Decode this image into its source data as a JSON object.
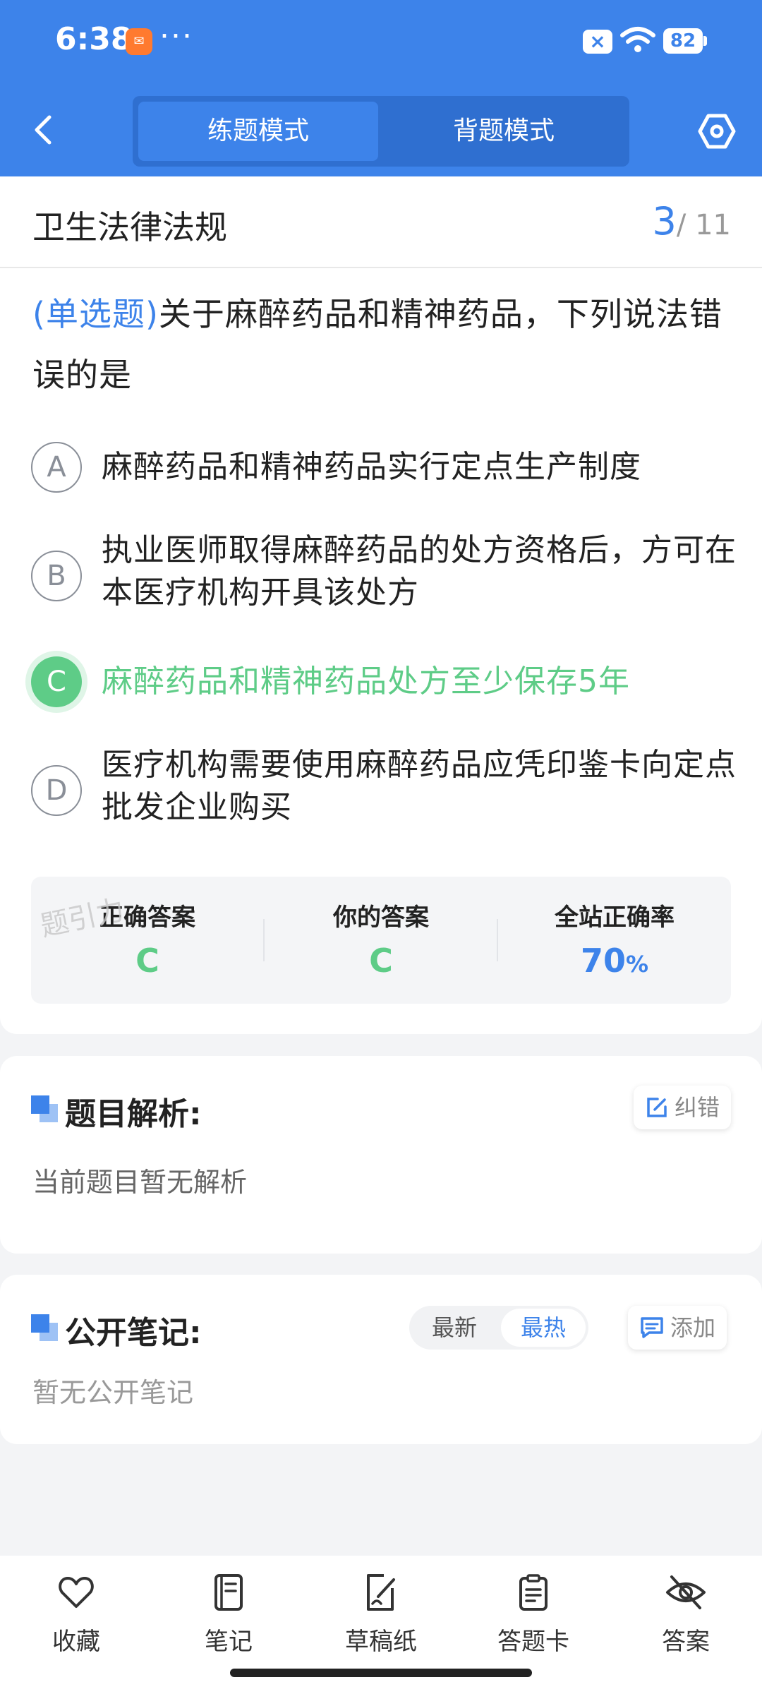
{
  "status_bar": {
    "time": "6:38",
    "dots": "···",
    "battery": "82"
  },
  "header": {
    "modes": [
      "练题模式",
      "背题模式"
    ],
    "active_mode": "练题模式"
  },
  "subject": {
    "title": "卫生法律法规",
    "current": "3",
    "total": "/ 11"
  },
  "question": {
    "type": "(单选题)",
    "text": "关于麻醉药品和精神药品，下列说法错误的是",
    "options": [
      {
        "letter": "A",
        "text": "麻醉药品和精神药品实行定点生产制度"
      },
      {
        "letter": "B",
        "text": "执业医师取得麻醉药品的处方资格后，方可在本医疗机构开具该处方"
      },
      {
        "letter": "C",
        "text": "麻醉药品和精神药品处方至少保存5年",
        "correct": true
      },
      {
        "letter": "D",
        "text": "医疗机构需要使用麻醉药品应凭印鉴卡向定点批发企业购买"
      }
    ]
  },
  "answer_summary": {
    "watermark": "题引力",
    "correct_label": "正确答案",
    "correct_value": "C",
    "yours_label": "你的答案",
    "yours_value": "C",
    "rate_label": "全站正确率",
    "rate_value": "70",
    "rate_unit": "%"
  },
  "analysis": {
    "title": "题目解析:",
    "correct_button": "纠错",
    "body": "当前题目暂无解析"
  },
  "notes": {
    "title": "公开笔记:",
    "sort_latest": "最新",
    "sort_hot": "最热",
    "add_button": "添加",
    "body": "暂无公开笔记"
  },
  "bottom_tabs": [
    "收藏",
    "笔记",
    "草稿纸",
    "答题卡",
    "答案"
  ],
  "colors": {
    "primary": "#3d83ea",
    "correct": "#5ecc87"
  }
}
